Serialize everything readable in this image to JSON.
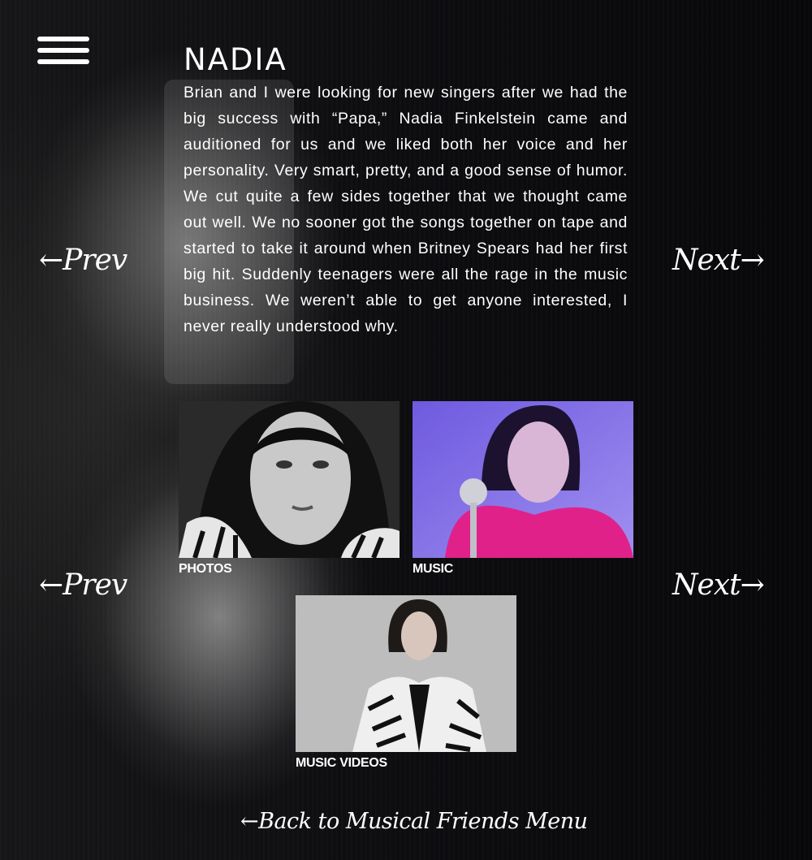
{
  "page": {
    "title": "NADIA",
    "story": "Brian and I were looking for new singers after we had the big success with “Papa,” Nadia Finkelstein came and auditioned for us and we liked both her voice and her personality. Very smart, pretty, and a good sense of humor. We cut quite a few sides together that we thought came out well. We no sooner got the songs together on tape and started to take it around when Britney Spears had her first big hit. Suddenly teenagers were all the rage in the music business. We weren’t able to get anyone interested, I never really understood why."
  },
  "nav": {
    "menu_icon": "hamburger-menu-icon",
    "prev_label": "←Prev",
    "next_label": "Next→",
    "back_label": "←Back to Musical Friends Menu"
  },
  "tiles": [
    {
      "label": "PHOTOS",
      "tone": "grayscale"
    },
    {
      "label": "MUSIC",
      "tone": "#8a73e6"
    },
    {
      "label": "MUSIC VIDEOS",
      "tone": "#bfbfbf"
    }
  ]
}
